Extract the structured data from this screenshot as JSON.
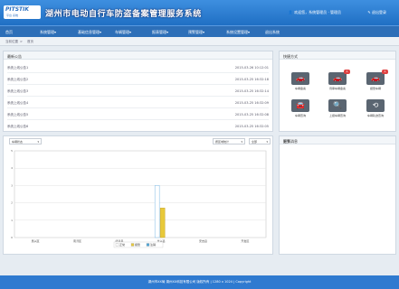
{
  "header": {
    "logo_main": "PITSTIK",
    "logo_sub": "平台 系统",
    "title": "湖州市电动自行车防盗备案管理服务系统",
    "user_text": "欢迎您，系统管理员 · 管理员",
    "logout_label": "退出登录"
  },
  "nav": {
    "items": [
      "首页",
      "系统管理",
      "基础信息管理",
      "车辆管理",
      "报表管理",
      "预警管理",
      "系统设置管理",
      "退出系统"
    ]
  },
  "breadcrumb": {
    "items": [
      "当前位置",
      "首页"
    ]
  },
  "notices": {
    "title": "最新公告",
    "rows": [
      {
        "name": "系统上线公告1",
        "time": "2015-03-26 10:12:01"
      },
      {
        "name": "系统上线公告2",
        "time": "2015-03-25 16:32:18"
      },
      {
        "name": "系统上线公告3",
        "time": "2015-03-25 16:32:14"
      },
      {
        "name": "系统上线公告4",
        "time": "2015-03-25 16:32:09"
      },
      {
        "name": "系统上线公告5",
        "time": "2015-03-25 16:32:08"
      },
      {
        "name": "系统上线公告6",
        "time": "2015-03-25 16:32:05"
      }
    ]
  },
  "shortcuts": {
    "title": "快捷方式",
    "items": [
      {
        "label": "车辆备案",
        "icon": "car-icon",
        "glyph": "🚗",
        "badge": ""
      },
      {
        "label": "待审车辆备案",
        "icon": "car-pending-icon",
        "glyph": "🚗",
        "badge": "1"
      },
      {
        "label": "报警车辆",
        "icon": "alarm-car-icon",
        "glyph": "🚗",
        "badge": "1"
      },
      {
        "label": "车辆查询",
        "icon": "car-query-icon",
        "glyph": "🚘",
        "badge": ""
      },
      {
        "label": "上报车辆查询",
        "icon": "search-icon",
        "glyph": "🔍",
        "badge": ""
      },
      {
        "label": "车辆轨迹查询",
        "icon": "history-icon",
        "glyph": "⟲",
        "badge": ""
      }
    ]
  },
  "chart_panel": {
    "select_left": "车辆状态",
    "select_mid": "按区域统计",
    "select_right": "全部"
  },
  "chart_data": {
    "type": "bar",
    "categories": [
      "吴兴区",
      "南浔区",
      "德清县",
      "长兴县",
      "安吉县",
      "开发区"
    ],
    "series": [
      {
        "name": "正常",
        "color": "#ffffff",
        "values": [
          0,
          0,
          0,
          3,
          0,
          0
        ]
      },
      {
        "name": "报警",
        "color": "#e8c93a",
        "values": [
          0,
          0,
          0,
          1.7,
          0,
          0
        ]
      },
      {
        "name": "注销",
        "color": "#4fa6d8",
        "values": [
          0,
          0,
          0,
          0,
          0,
          0
        ]
      }
    ],
    "yticks": [
      0,
      1,
      2,
      3,
      4,
      5
    ],
    "ylim": [
      0,
      5
    ]
  },
  "warning_panel": {
    "title": "报警消息",
    "more_label": "更多..."
  },
  "footer": {
    "text": "湖州市XX局 湖州XX科技有限公司 版权所有 | 1280 x 1024 | Copyright"
  }
}
